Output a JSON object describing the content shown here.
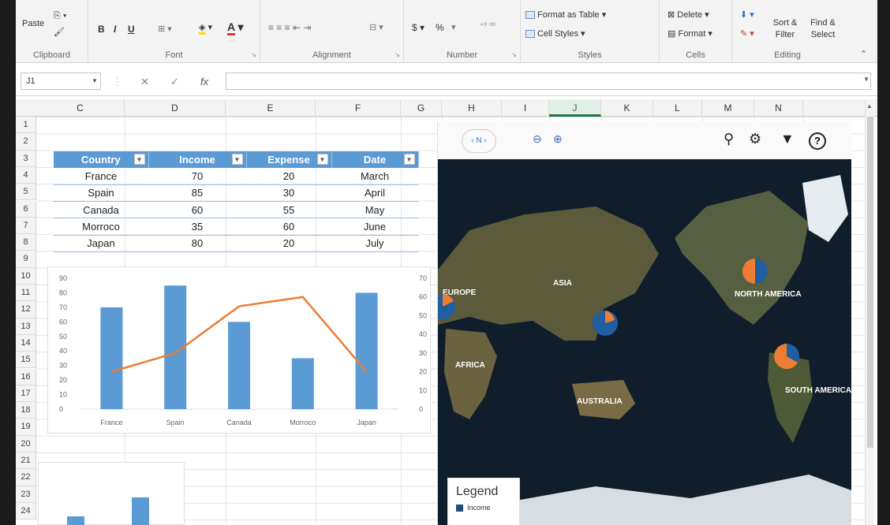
{
  "ribbon": {
    "clipboard": {
      "label": "Clipboard",
      "paste": "Paste"
    },
    "font": {
      "label": "Font",
      "bold": "B",
      "italic": "I",
      "underline": "U"
    },
    "alignment": {
      "label": "Alignment"
    },
    "number": {
      "label": "Number",
      "currency": "$",
      "percent": "%"
    },
    "styles": {
      "label": "Styles",
      "format_as_table": "Format as Table",
      "cell_styles": "Cell Styles"
    },
    "cells": {
      "label": "Cells",
      "delete": "Delete",
      "format": "Format"
    },
    "editing": {
      "label": "Editing",
      "sort_filter": "Sort & Filter",
      "find_select": "Find & Select"
    }
  },
  "formula_bar": {
    "name_box": "J1",
    "fx": "fx",
    "cancel": "✕",
    "enter": "✓",
    "value": ""
  },
  "columns": [
    "C",
    "D",
    "E",
    "F",
    "G",
    "H",
    "I",
    "J",
    "K",
    "L",
    "M",
    "N"
  ],
  "selected_column": "J",
  "rows": [
    "1",
    "2",
    "3",
    "4",
    "5",
    "6",
    "7",
    "8",
    "9",
    "10",
    "11",
    "12",
    "13",
    "14",
    "15",
    "16",
    "17",
    "18",
    "19",
    "20",
    "21",
    "22",
    "23",
    "24"
  ],
  "table": {
    "headers": [
      "Country",
      "Income",
      "Expense",
      "Date"
    ],
    "rows": [
      [
        "France",
        "70",
        "20",
        "March"
      ],
      [
        "Spain",
        "85",
        "30",
        "April"
      ],
      [
        "Canada",
        "60",
        "55",
        "May"
      ],
      [
        "Morroco",
        "35",
        "60",
        "June"
      ],
      [
        "Japan",
        "80",
        "20",
        "July"
      ]
    ]
  },
  "chart_data": {
    "type": "bar",
    "categories": [
      "France",
      "Spain",
      "Canada",
      "Morroco",
      "Japan"
    ],
    "series": [
      {
        "values": [
          70,
          85,
          60,
          35,
          80
        ],
        "color": "#5b9bd5",
        "kind": "bar",
        "axis": "left"
      },
      {
        "values": [
          20,
          30,
          55,
          60,
          20
        ],
        "color": "#ed7d31",
        "kind": "line",
        "axis": "right"
      }
    ],
    "ylim": [
      0,
      90
    ],
    "y2lim": [
      0,
      70
    ],
    "yticks": [
      "90",
      "80",
      "70",
      "60",
      "50",
      "40",
      "30",
      "20",
      "10",
      "0"
    ],
    "y2ticks": [
      "70",
      "60",
      "50",
      "40",
      "30",
      "20",
      "10",
      "0"
    ]
  },
  "map": {
    "labels": [
      "EUROPE",
      "ASIA",
      "AFRICA",
      "AUSTRALIA",
      "NORTH AMERICA",
      "SOUTH AMERICA"
    ],
    "legend_title": "Legend",
    "legend_item": "Income",
    "colors": {
      "income": "#1f4e79",
      "expense": "#ed7d31"
    }
  }
}
